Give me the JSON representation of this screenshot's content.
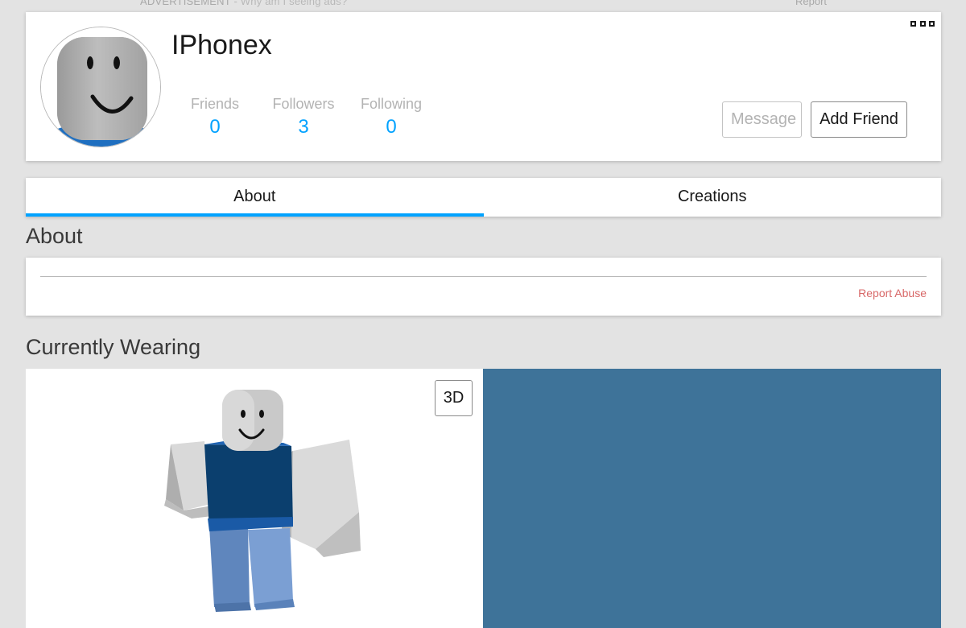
{
  "ad_bar": {
    "label": "ADVERTISEMENT",
    "why": " - Why am I seeing ads?",
    "report": "Report"
  },
  "profile": {
    "username": "IPhonex",
    "stats": [
      {
        "label": "Friends",
        "value": "0"
      },
      {
        "label": "Followers",
        "value": "3"
      },
      {
        "label": "Following",
        "value": "0"
      }
    ],
    "message_label": "Message",
    "add_friend_label": "Add Friend",
    "more_icon": "more-options-icon"
  },
  "tabs": [
    {
      "label": "About",
      "active": true
    },
    {
      "label": "Creations",
      "active": false
    }
  ],
  "about": {
    "title": "About",
    "report_abuse": "Report Abuse"
  },
  "wearing": {
    "title": "Currently Wearing",
    "view_3d_label": "3D"
  },
  "colors": {
    "accent": "#00a2ff",
    "background": "#e3e3e3",
    "panel_blue": "#3e7399",
    "report_red": "#d86868",
    "shirt": "#0b3f6e",
    "pants": "#6a92c8"
  }
}
